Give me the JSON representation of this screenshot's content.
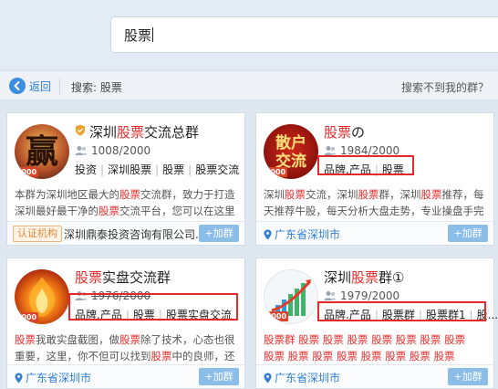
{
  "search": {
    "query": "股票"
  },
  "nav": {
    "back_label": "返回",
    "summary": "搜索: 股票",
    "help_link": "搜索不到我的群？"
  },
  "colors": {
    "accent": "#2f7fd6",
    "keyword_red": "#e52b2b",
    "join_button": "#8bbde9",
    "highlight_border": "#e22a2a"
  },
  "cards": [
    {
      "title_prefix": "深圳",
      "title_keyword": "股票",
      "title_suffix": "交流总群",
      "verified_icon": "shield-badge-icon",
      "count": "1008/2000",
      "tags": [
        "投资",
        "深圳股票",
        "股票",
        "股票交流"
      ],
      "desc_parts": [
        "本群为深圳地区最大的",
        "股票",
        "交流群，致力于打造深圳最好最干净的",
        "股票",
        "交流平台，您可以在这里自..."
      ],
      "certification": "认证机构",
      "company": "深圳鼎泰投资咨询有限公司...",
      "join_label": "+加群",
      "avatar_text": "赢",
      "avatar_badge": "2000"
    },
    {
      "title_keyword": "股票",
      "title_suffix": "の",
      "count": "1984/2000",
      "tags": [
        "品牌.产品",
        "股票"
      ],
      "desc_parts": [
        "深圳",
        "股票",
        "交流，深圳",
        "股票",
        "群，深圳",
        "股票",
        "推荐，每天推荐牛股，每天分析大盘走势，专业操盘手完全..."
      ],
      "location": "广东省深圳市",
      "join_label": "+加群",
      "avatar_text_top": "散户",
      "avatar_text_bottom": "交流",
      "avatar_badge": "2000"
    },
    {
      "title_keyword": "股票",
      "title_suffix": "实盘交流群",
      "count": "1976/2000",
      "tags": [
        "品牌.产品",
        "股票",
        "股票实盘交流"
      ],
      "desc_parts": [
        "",
        "股票",
        "我敢实盘截图，做",
        "股票",
        "除了技术，心态也很重要，这里，你不但可以找到",
        "股票",
        "中的良师，还可..."
      ],
      "location": "广东省深圳市",
      "join_label": "+加群",
      "avatar_badge": "2000"
    },
    {
      "title_prefix": "深圳",
      "title_keyword": "股票",
      "title_suffix": "群①",
      "count": "1979/2000",
      "tags": [
        "品牌.产品",
        "股票群",
        "股票群1",
        "股..."
      ],
      "keyword_lines": [
        "股票群 股票 股票 股票 股票 股票 股票 股票",
        "股票 股票 股票 股票 股票 股票 股票 股票"
      ],
      "location": "广东省深圳市",
      "join_label": "+加群",
      "avatar_badge": "2000"
    }
  ]
}
